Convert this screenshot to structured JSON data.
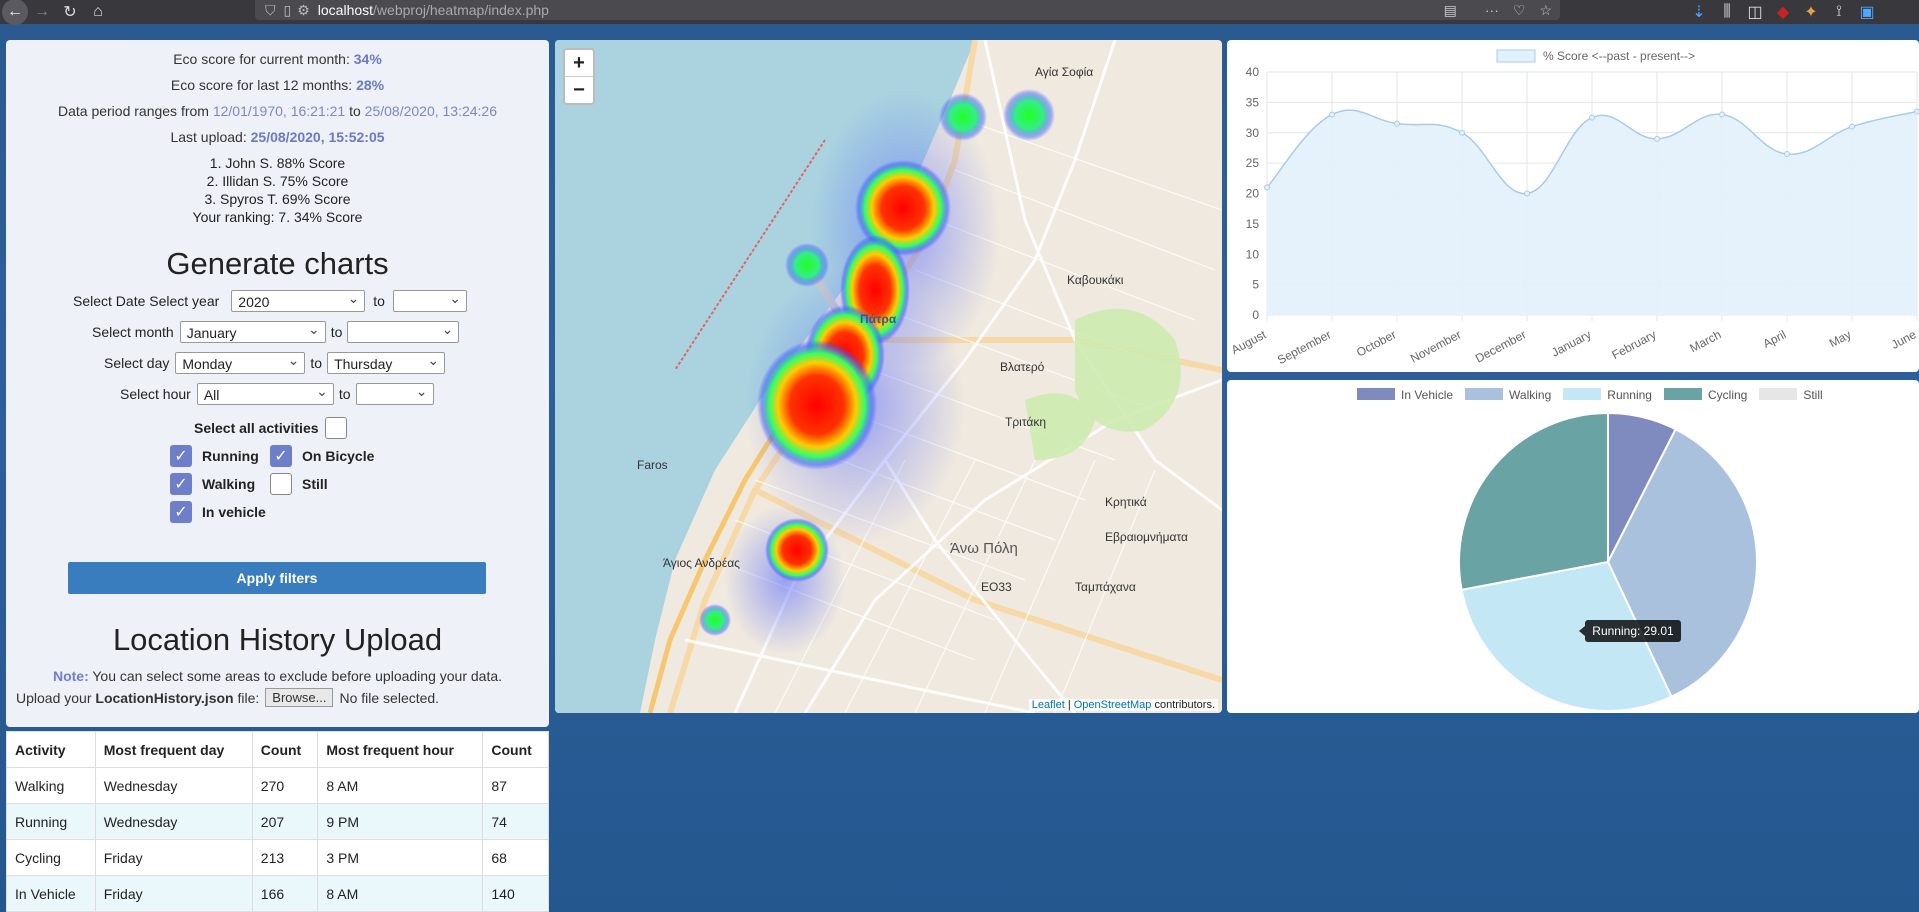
{
  "browser": {
    "url_host": "localhost",
    "url_path": "/webproj/heatmap/index.php"
  },
  "stats": {
    "eco_current_label": "Eco score for current month:",
    "eco_current_value": "34%",
    "eco_year_label": "Eco score for last 12 months:",
    "eco_year_value": "28%",
    "period_label": "Data period ranges from",
    "period_from": "12/01/1970, 16:21:21",
    "period_to_word": "to",
    "period_to": "25/08/2020, 13:24:26",
    "last_upload_label": "Last upload:",
    "last_upload_value": "25/08/2020, 15:52:05",
    "leaderboard": [
      "1. John S. 88% Score",
      "2. Illidan S. 75% Score",
      "3. Spyros T. 69% Score",
      "Your ranking: 7. 34% Score"
    ]
  },
  "filters": {
    "title": "Generate charts",
    "date_label": "Select Date Select year",
    "year_from": "2020",
    "year_to": "",
    "month_label": "Select month",
    "month_from": "January",
    "month_to": "",
    "day_label": "Select day",
    "day_from": "Monday",
    "day_to": "Thursday",
    "hour_label": "Select hour",
    "hour_from": "All",
    "hour_to": "",
    "to": "to",
    "select_all_label": "Select all activities",
    "select_all_checked": false,
    "activities": [
      {
        "label": "Running",
        "checked": true
      },
      {
        "label": "On Bicycle",
        "checked": true
      },
      {
        "label": "Walking",
        "checked": true
      },
      {
        "label": "Still",
        "checked": false
      },
      {
        "label": "In vehicle",
        "checked": true
      }
    ],
    "apply_label": "Apply filters"
  },
  "upload": {
    "title": "Location History Upload",
    "note_label": "Note:",
    "note_text": "You can select some areas to exclude before uploading your data.",
    "upload_prefix": "Upload your",
    "upload_file": "LocationHistory.json",
    "upload_suffix": "file:",
    "browse_label": "Browse...",
    "no_file": "No file selected."
  },
  "map": {
    "zoom_in": "+",
    "zoom_out": "−",
    "attribution_leaflet": "Leaflet",
    "attribution_sep": "|",
    "attribution_osm": "OpenStreetMap",
    "attribution_suffix": "contributors.",
    "labels": {
      "patra": "Πάτρα",
      "ano_poli": "Άνω Πόλη",
      "vlatero": "Βλατερό",
      "kalavokaki": "Καβουκάκι",
      "faros": "Faros",
      "agios_andreas": "Άγιος Ανδρέας",
      "eo33": "ΕΟ33",
      "kritika": "Κρητικά",
      "tampachana": "Ταμπάχανα",
      "agia_sofia": "Αγία Σοφία",
      "evraiomnimata": "Εβραιομνήματα",
      "tritakh": "Τριτάκη",
      "ag_andreas2": "Άγιος Ανδρέας"
    }
  },
  "chart_data": [
    {
      "type": "area",
      "legend": "% Score <--past - present-->",
      "categories": [
        "August",
        "September",
        "October",
        "November",
        "December",
        "January",
        "February",
        "March",
        "April",
        "May",
        "June"
      ],
      "values": [
        21,
        33,
        31.5,
        30,
        20,
        32.5,
        29,
        33,
        26.5,
        31,
        33.5
      ],
      "yticks": [
        0,
        5,
        10,
        15,
        20,
        25,
        30,
        35,
        40
      ],
      "ylim": [
        0,
        40
      ],
      "grid": true,
      "colors": {
        "line": "#a8cce6",
        "fill": "#e3f1fb"
      }
    },
    {
      "type": "pie",
      "legend_position": "top",
      "categories": [
        "In Vehicle",
        "Walking",
        "Running",
        "Cycling",
        "Still"
      ],
      "values": [
        7.5,
        35.5,
        29.01,
        28,
        0
      ],
      "colors": [
        "#7f8abf",
        "#a9c1dc",
        "#c3e7f5",
        "#69a3a3",
        "#e6e6e6"
      ],
      "tooltip": "Running: 29.01"
    }
  ],
  "table": {
    "headers": [
      "Activity",
      "Most frequent day",
      "Count",
      "Most frequent hour",
      "Count"
    ],
    "rows": [
      [
        "Walking",
        "Wednesday",
        "270",
        "8 AM",
        "87"
      ],
      [
        "Running",
        "Wednesday",
        "207",
        "9 PM",
        "74"
      ],
      [
        "Cycling",
        "Friday",
        "213",
        "3 PM",
        "68"
      ],
      [
        "In Vehicle",
        "Friday",
        "166",
        "8 AM",
        "140"
      ]
    ]
  }
}
